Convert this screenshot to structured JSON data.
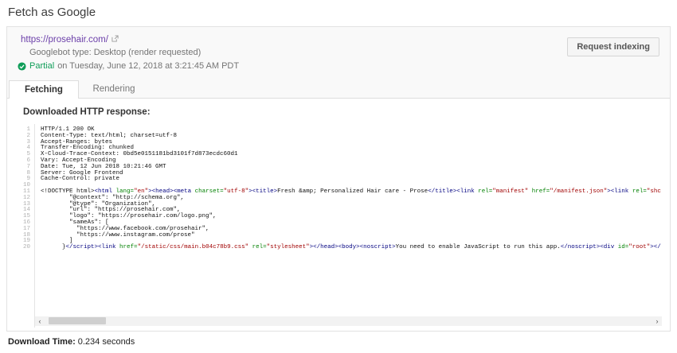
{
  "page": {
    "title": "Fetch as Google"
  },
  "colors": {
    "link": "#6b3fa9",
    "green": "#0f9d58",
    "tag": "#000080",
    "atn": "#008000",
    "atv": "#a00000"
  },
  "card": {
    "url": "https://prosehair.com/",
    "googlebot_type": "Googlebot type: Desktop (render requested)",
    "status": {
      "label": "Partial",
      "detail": "on Tuesday, June 12, 2018 at 3:21:45 AM PDT"
    },
    "request_indexing_label": "Request indexing",
    "tabs": [
      {
        "label": "Fetching",
        "active": true
      },
      {
        "label": "Rendering",
        "active": false
      }
    ]
  },
  "response": {
    "heading": "Downloaded HTTP response:",
    "code_lines": [
      [
        {
          "t": "pln",
          "s": "HTTP/1.1 200 OK"
        }
      ],
      [
        {
          "t": "pln",
          "s": "Content-Type: text/html; charset=utf-8"
        }
      ],
      [
        {
          "t": "pln",
          "s": "Accept-Ranges: bytes"
        }
      ],
      [
        {
          "t": "pln",
          "s": "Transfer-Encoding: chunked"
        }
      ],
      [
        {
          "t": "pln",
          "s": "X-Cloud-Trace-Context: 0bd5e0151181bd3101f7d873ecdc60d1"
        }
      ],
      [
        {
          "t": "pln",
          "s": "Vary: Accept-Encoding"
        }
      ],
      [
        {
          "t": "pln",
          "s": "Date: Tue, 12 Jun 2018 10:21:46 GMT"
        }
      ],
      [
        {
          "t": "pln",
          "s": "Server: Google Frontend"
        }
      ],
      [
        {
          "t": "pln",
          "s": "Cache-Control: private"
        }
      ],
      [],
      [
        {
          "t": "pln",
          "s": "<!DOCTYPE html>"
        },
        {
          "t": "tag",
          "s": "<html"
        },
        {
          "t": "pln",
          "s": " "
        },
        {
          "t": "atn",
          "s": "lang="
        },
        {
          "t": "atv",
          "s": "\"en\""
        },
        {
          "t": "tag",
          "s": "><head><meta"
        },
        {
          "t": "pln",
          "s": " "
        },
        {
          "t": "atn",
          "s": "charset="
        },
        {
          "t": "atv",
          "s": "\"utf-8\""
        },
        {
          "t": "tag",
          "s": "><title>"
        },
        {
          "t": "pln",
          "s": "Fresh &amp; Personalized Hair care - Prose"
        },
        {
          "t": "tag",
          "s": "</title><link"
        },
        {
          "t": "pln",
          "s": " "
        },
        {
          "t": "atn",
          "s": "rel="
        },
        {
          "t": "atv",
          "s": "\"manifest\""
        },
        {
          "t": "pln",
          "s": " "
        },
        {
          "t": "atn",
          "s": "href="
        },
        {
          "t": "atv",
          "s": "\"/manifest.json\""
        },
        {
          "t": "tag",
          "s": "><link"
        },
        {
          "t": "pln",
          "s": " "
        },
        {
          "t": "atn",
          "s": "rel="
        },
        {
          "t": "atv",
          "s": "\"shc"
        }
      ],
      [
        {
          "t": "pln",
          "s": "        \"@context\": \"http://schema.org\","
        }
      ],
      [
        {
          "t": "pln",
          "s": "        \"@type\": \"Organization\","
        }
      ],
      [
        {
          "t": "pln",
          "s": "        \"url\": \"https://prosehair.com\","
        }
      ],
      [
        {
          "t": "pln",
          "s": "        \"logo\": \"https://prosehair.com/logo.png\","
        }
      ],
      [
        {
          "t": "pln",
          "s": "        \"sameAs\": ["
        }
      ],
      [
        {
          "t": "pln",
          "s": "          \"https://www.facebook.com/prosehair\","
        }
      ],
      [
        {
          "t": "pln",
          "s": "          \"https://www.instagram.com/prose\""
        }
      ],
      [
        {
          "t": "pln",
          "s": "        ]"
        }
      ],
      [
        {
          "t": "pln",
          "s": "      }"
        },
        {
          "t": "tag",
          "s": "</script><link"
        },
        {
          "t": "pln",
          "s": " "
        },
        {
          "t": "atn",
          "s": "href="
        },
        {
          "t": "atv",
          "s": "\"/static/css/main.b04c78b9.css\""
        },
        {
          "t": "pln",
          "s": " "
        },
        {
          "t": "atn",
          "s": "rel="
        },
        {
          "t": "atv",
          "s": "\"stylesheet\""
        },
        {
          "t": "tag",
          "s": "></head><body><noscript>"
        },
        {
          "t": "pln",
          "s": "You need to enable JavaScript to run this app."
        },
        {
          "t": "tag",
          "s": "</noscript><div"
        },
        {
          "t": "pln",
          "s": " "
        },
        {
          "t": "atn",
          "s": "id="
        },
        {
          "t": "atv",
          "s": "\"root\""
        },
        {
          "t": "tag",
          "s": "></"
        }
      ]
    ]
  },
  "footer": {
    "download_time_label": "Download Time:",
    "download_time_value": "0.234 seconds"
  }
}
